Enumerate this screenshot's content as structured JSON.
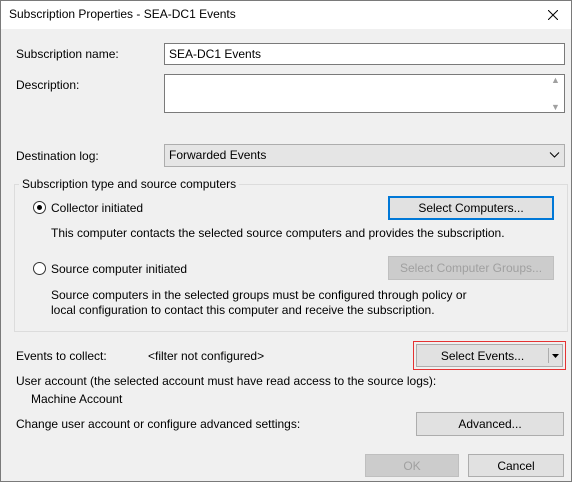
{
  "window": {
    "title": "Subscription Properties - SEA-DC1 Events"
  },
  "subscription_name": {
    "label": "Subscription name:",
    "value": "SEA-DC1 Events"
  },
  "description": {
    "label": "Description:",
    "value": ""
  },
  "destination_log": {
    "label": "Destination log:",
    "selected": "Forwarded Events"
  },
  "subscription_type": {
    "group_title": "Subscription type and source computers",
    "collector": {
      "label": "Collector initiated",
      "checked": true,
      "button_label": "Select Computers...",
      "description": "This computer contacts the selected source computers and provides the subscription."
    },
    "source": {
      "label": "Source computer initiated",
      "checked": false,
      "button_label": "Select Computer Groups...",
      "description_line1": "Source computers in the selected groups must be configured through policy or",
      "description_line2": "local configuration to contact this computer and receive the subscription."
    }
  },
  "events": {
    "label": "Events to collect:",
    "filter_status": "<filter not configured>",
    "button_label": "Select Events..."
  },
  "user_account": {
    "label": "User account (the selected account must have read access to the source logs):",
    "value": "Machine Account"
  },
  "advanced": {
    "label": "Change user account or configure advanced settings:",
    "button_label": "Advanced..."
  },
  "footer": {
    "ok_label": "OK",
    "cancel_label": "Cancel"
  },
  "icons": {
    "close": "close-icon",
    "dropdown": "chevron-down-icon"
  },
  "colors": {
    "highlight_border": "#e53333",
    "focus_border": "#0078d7"
  }
}
